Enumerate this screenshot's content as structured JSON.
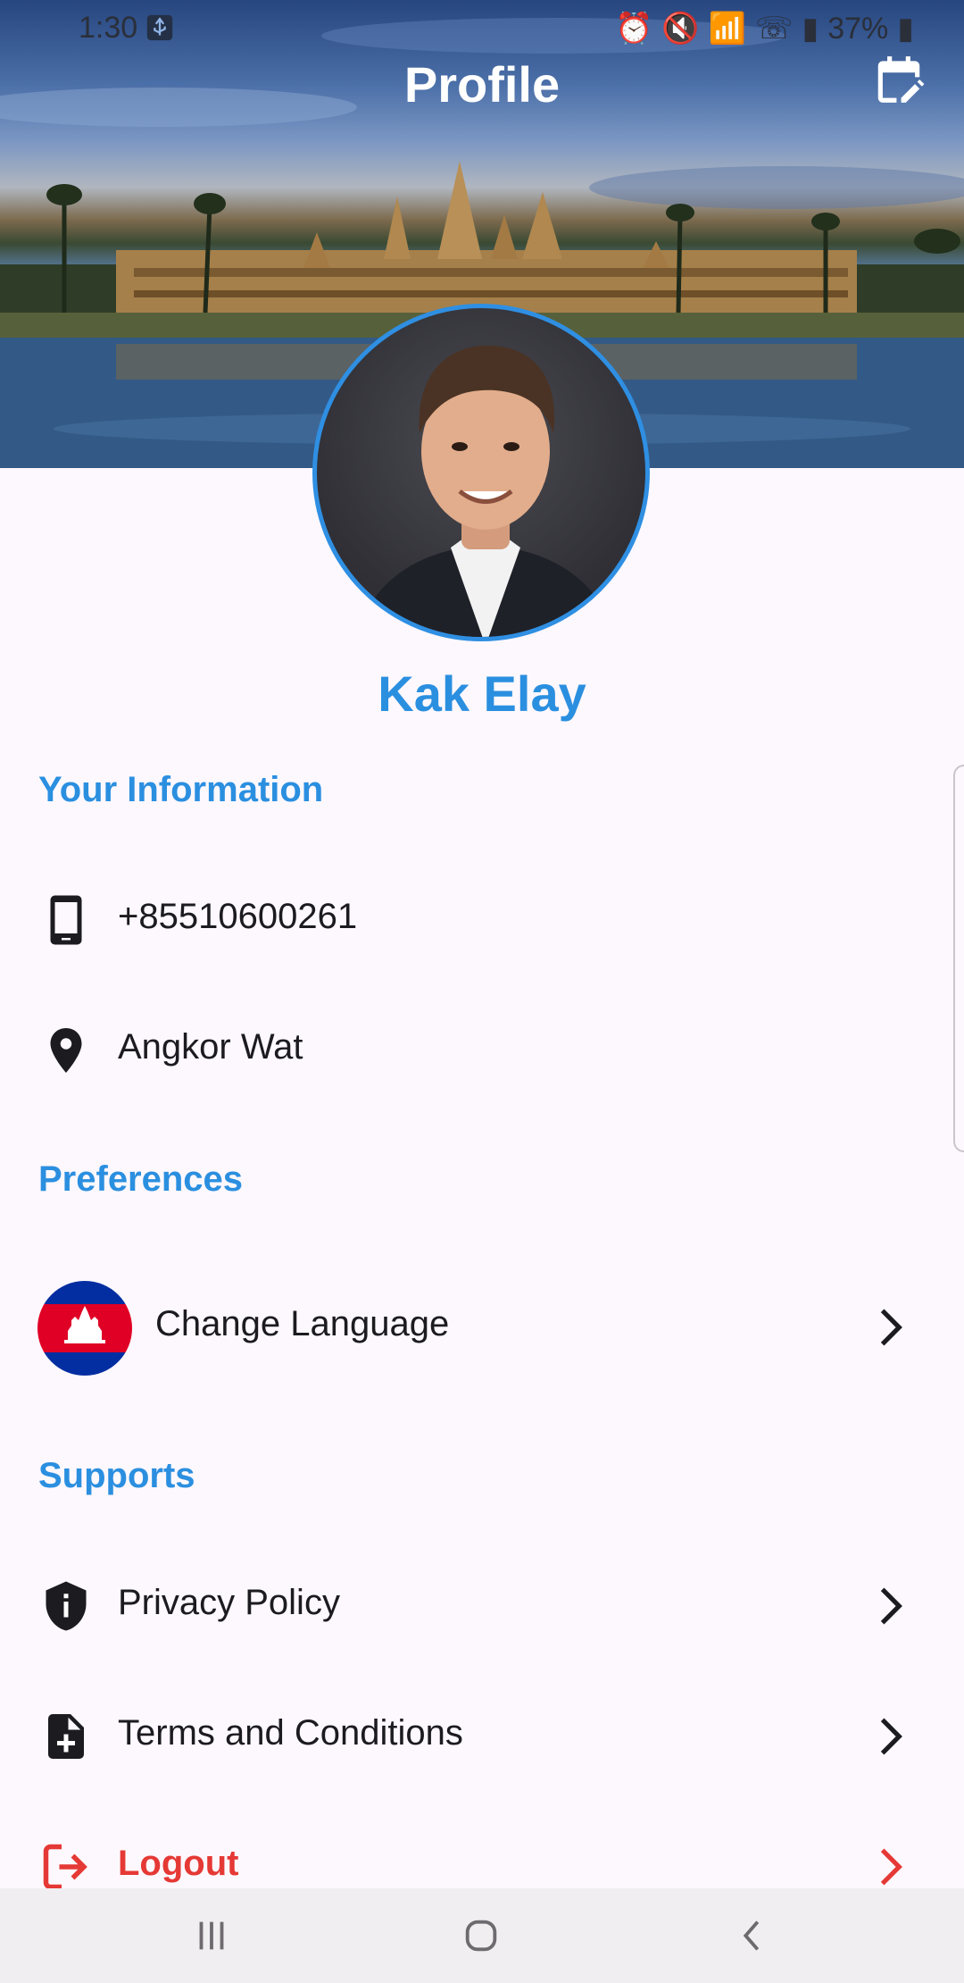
{
  "status_bar": {
    "time": "1:30",
    "battery": "37%"
  },
  "header": {
    "title": "Profile"
  },
  "profile": {
    "name": "Kak Elay"
  },
  "sections": {
    "info_title": "Your Information",
    "preferences_title": "Preferences",
    "supports_title": "Supports"
  },
  "info": {
    "phone": "+85510600261",
    "location": "Angkor Wat"
  },
  "preferences": {
    "language_label": "Change Language"
  },
  "supports": {
    "privacy_label": "Privacy Policy",
    "terms_label": "Terms and Conditions",
    "logout_label": "Logout"
  },
  "colors": {
    "accent": "#2b8fe0",
    "danger": "#e53935",
    "background": "#fdf8fd"
  },
  "icons": {
    "phone": "phone-icon",
    "location": "location-pin-icon",
    "privacy": "shield-info-icon",
    "terms": "document-add-icon",
    "logout": "logout-icon",
    "edit": "calendar-edit-icon",
    "chevron": "chevron-right-icon"
  }
}
